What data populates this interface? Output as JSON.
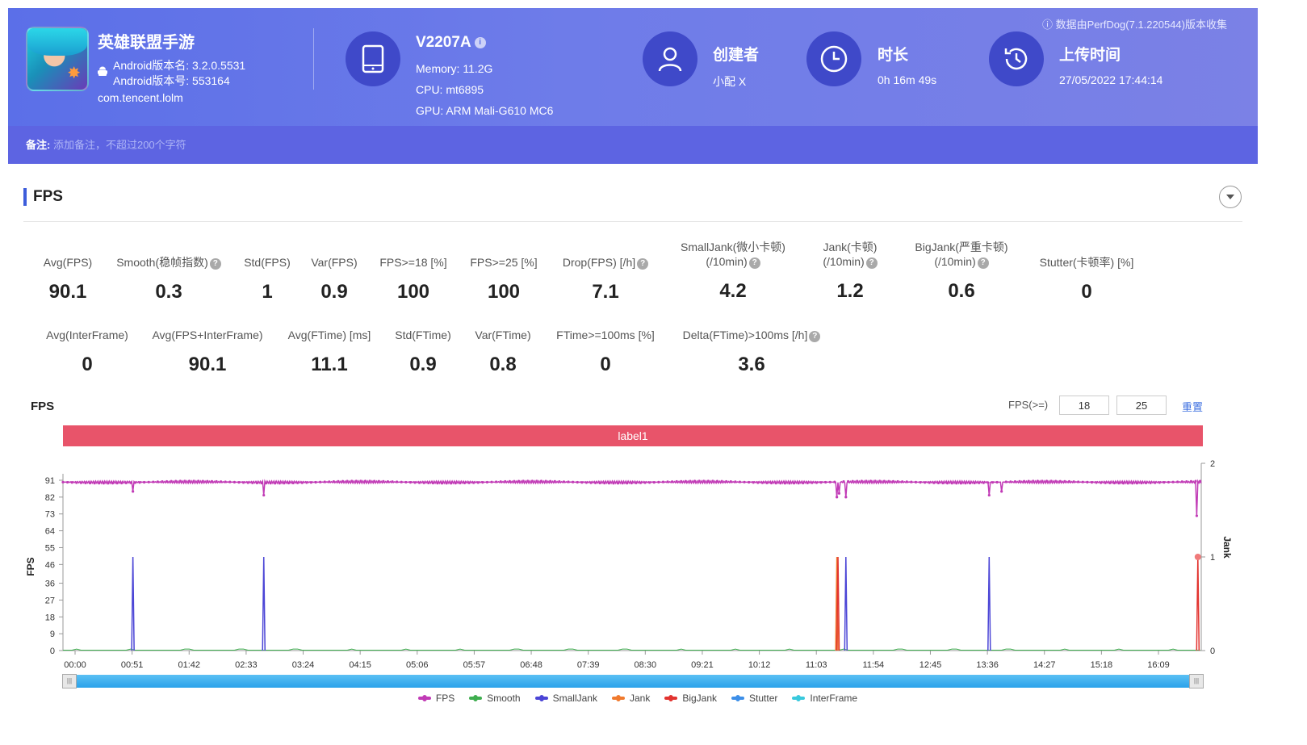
{
  "header": {
    "collect_note": "数据由PerfDog(7.1.220544)版本收集",
    "app": {
      "name": "英雄联盟手游",
      "version_name": "Android版本名: 3.2.0.5531",
      "version_code": "Android版本号: 553164",
      "package": "com.tencent.lolm"
    },
    "device": {
      "model": "V2207A",
      "memory": "Memory: 11.2G",
      "cpu": "CPU: mt6895",
      "gpu": "GPU: ARM Mali-G610 MC6"
    },
    "creator": {
      "title": "创建者",
      "value": "小配 X"
    },
    "duration": {
      "title": "时长",
      "value": "0h 16m 49s"
    },
    "upload": {
      "title": "上传时间",
      "value": "27/05/2022 17:44:14"
    },
    "note": {
      "label": "备注:",
      "placeholder": "添加备注，不超过200个字符"
    },
    "colors": {
      "gradient_start": "#5b6fe8",
      "gradient_end": "#7b81e6",
      "icon_circle": "#3f49c9"
    }
  },
  "fps_section": {
    "title": "FPS",
    "metrics_row1": [
      {
        "label": "Avg(FPS)",
        "value": "90.1"
      },
      {
        "label": "Smooth(稳帧指数)",
        "value": "0.3",
        "help": true
      },
      {
        "label": "Std(FPS)",
        "value": "1"
      },
      {
        "label": "Var(FPS)",
        "value": "0.9"
      },
      {
        "label": "FPS>=18 [%]",
        "value": "100"
      },
      {
        "label": "FPS>=25 [%]",
        "value": "100"
      },
      {
        "label": "Drop(FPS) [/h]",
        "value": "7.1",
        "help": true
      },
      {
        "label": "SmallJank(微小卡顿)",
        "label2": "(/10min)",
        "value": "4.2",
        "help": true
      },
      {
        "label": "Jank(卡顿)",
        "label2": "(/10min)",
        "value": "1.2",
        "help": true
      },
      {
        "label": "BigJank(严重卡顿)",
        "label2": "(/10min)",
        "value": "0.6",
        "help": true
      },
      {
        "label": "Stutter(卡顿率) [%]",
        "value": "0"
      }
    ],
    "metrics_row2": [
      {
        "label": "Avg(InterFrame)",
        "value": "0"
      },
      {
        "label": "Avg(FPS+InterFrame)",
        "value": "90.1"
      },
      {
        "label": "Avg(FTime) [ms]",
        "value": "11.1"
      },
      {
        "label": "Std(FTime)",
        "value": "0.9"
      },
      {
        "label": "Var(FTime)",
        "value": "0.8"
      },
      {
        "label": "FTime>=100ms [%]",
        "value": "0"
      },
      {
        "label": "Delta(FTime)>100ms [/h]",
        "value": "3.6",
        "help": true
      }
    ]
  },
  "chart_controls": {
    "title": "FPS",
    "threshold_label": "FPS(>=)",
    "threshold_low": "18",
    "threshold_high": "25",
    "reset_label": "重置",
    "label_band": "label1"
  },
  "chart_data": {
    "type": "line",
    "title": "FPS",
    "ylabel": "FPS",
    "y2label": "Jank",
    "ylim": [
      0,
      91
    ],
    "y2lim": [
      0,
      2
    ],
    "yticks": [
      0,
      9,
      18,
      27,
      36,
      46,
      55,
      64,
      73,
      82,
      91
    ],
    "y2ticks": [
      0,
      1,
      2
    ],
    "xticks": [
      "00:00",
      "00:51",
      "01:42",
      "02:33",
      "03:24",
      "04:15",
      "05:06",
      "05:57",
      "06:48",
      "07:39",
      "08:30",
      "09:21",
      "10:12",
      "11:03",
      "11:54",
      "12:45",
      "13:36",
      "14:27",
      "15:18",
      "16:09"
    ],
    "x_max_seconds": 1009,
    "fps_baseline": 90,
    "fps_dips": [
      {
        "t": 62,
        "fps": 85
      },
      {
        "t": 178,
        "fps": 83
      },
      {
        "t": 686,
        "fps": 82
      },
      {
        "t": 688,
        "fps": 84
      },
      {
        "t": 694,
        "fps": 82
      },
      {
        "t": 821,
        "fps": 83
      },
      {
        "t": 832,
        "fps": 85
      },
      {
        "t": 1005,
        "fps": 72
      }
    ],
    "jank_events": [
      {
        "t": 62,
        "series": "SmallJank",
        "value": 1
      },
      {
        "t": 178,
        "series": "SmallJank",
        "value": 1
      },
      {
        "t": 686,
        "series": "Jank",
        "value": 1
      },
      {
        "t": 687,
        "series": "BigJank",
        "value": 1
      },
      {
        "t": 694,
        "series": "SmallJank",
        "value": 1
      },
      {
        "t": 821,
        "series": "SmallJank",
        "value": 1
      },
      {
        "t": 1006,
        "series": "BigJank",
        "value": 1
      }
    ],
    "series": [
      {
        "name": "FPS",
        "color": "#c13bb6"
      },
      {
        "name": "Smooth",
        "color": "#3fae4f"
      },
      {
        "name": "SmallJank",
        "color": "#4b45d6"
      },
      {
        "name": "Jank",
        "color": "#f07a2e"
      },
      {
        "name": "BigJank",
        "color": "#e2332f"
      },
      {
        "name": "Stutter",
        "color": "#3d8fe8"
      },
      {
        "name": "InterFrame",
        "color": "#39c9dd"
      }
    ],
    "legend_position": "bottom",
    "grid": false
  }
}
